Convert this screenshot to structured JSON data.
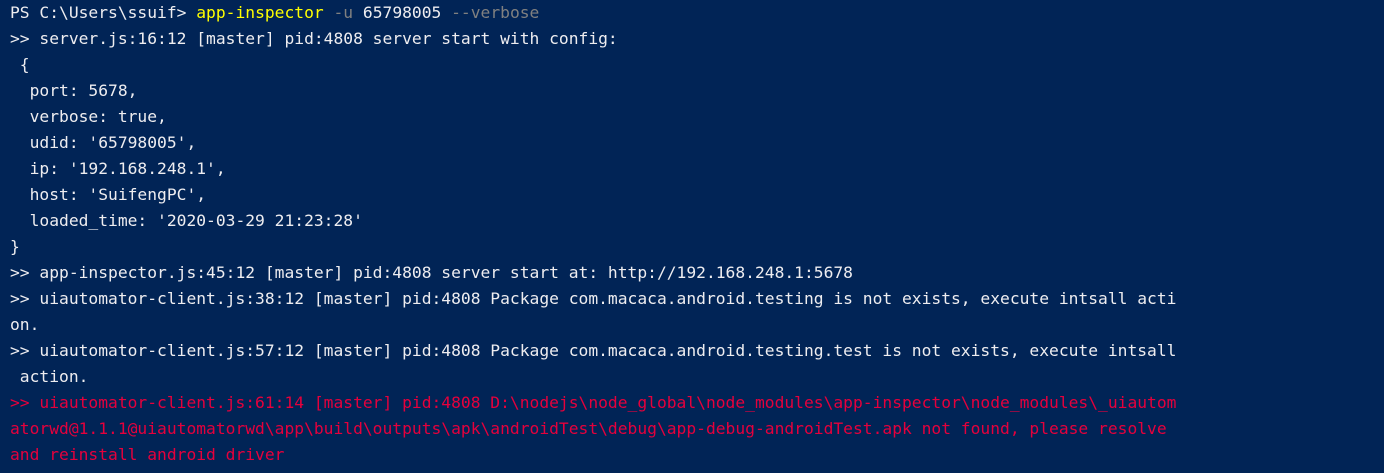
{
  "terminal": {
    "prompt": "PS C:\\Users\\ssuif> ",
    "command": "app-inspector",
    "flag_u": " -u ",
    "udid_arg": "65798005",
    "flag_verbose": " --verbose",
    "output_lines": [
      ">> server.js:16:12 [master] pid:4808 server start with config:",
      " {",
      "  port: 5678,",
      "  verbose: true,",
      "  udid: '65798005',",
      "  ip: '192.168.248.1',",
      "  host: 'SuifengPC',",
      "  loaded_time: '2020-03-29 21:23:28'",
      "}",
      ">> app-inspector.js:45:12 [master] pid:4808 server start at: http://192.168.248.1:5678",
      ">> uiautomator-client.js:38:12 [master] pid:4808 Package com.macaca.android.testing is not exists, execute intsall acti",
      "on.",
      ">> uiautomator-client.js:57:12 [master] pid:4808 Package com.macaca.android.testing.test is not exists, execute intsall",
      " action."
    ],
    "error_lines": [
      ">> uiautomator-client.js:61:14 [master] pid:4808 D:\\nodejs\\node_global\\node_modules\\app-inspector\\node_modules\\_uiautom",
      "atorwd@1.1.1@uiautomatorwd\\app\\build\\outputs\\apk\\androidTest\\debug\\app-debug-androidTest.apk not found, please resolve",
      "and reinstall android driver"
    ],
    "colors": {
      "background": "#012456",
      "text": "#eeedf0",
      "command": "#ffff00",
      "parameter": "#808080",
      "error": "#e5003c"
    }
  }
}
